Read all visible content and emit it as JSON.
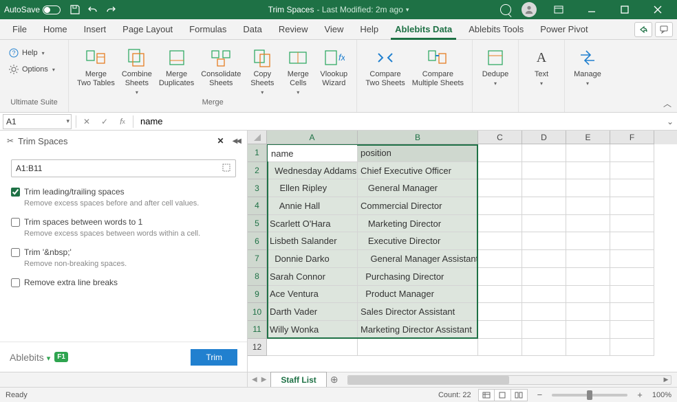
{
  "titlebar": {
    "autosave": "AutoSave",
    "doc_name": "Trim Spaces",
    "modified": "- Last Modified: 2m ago"
  },
  "tabs": {
    "file": "File",
    "home": "Home",
    "insert": "Insert",
    "pagelayout": "Page Layout",
    "formulas": "Formulas",
    "data": "Data",
    "review": "Review",
    "view": "View",
    "help": "Help",
    "abdata": "Ablebits Data",
    "abtools": "Ablebits Tools",
    "powerpivot": "Power Pivot"
  },
  "ribbon": {
    "help": "Help",
    "options": "Options",
    "group_ult": "Ultimate Suite",
    "merge_two_tables": "Merge\nTwo Tables",
    "combine_sheets": "Combine\nSheets",
    "merge_duplicates": "Merge\nDuplicates",
    "consolidate_sheets": "Consolidate\nSheets",
    "copy_sheets": "Copy\nSheets",
    "merge_cells": "Merge\nCells",
    "vlookup_wizard": "Vlookup\nWizard",
    "group_merge": "Merge",
    "compare_two": "Compare\nTwo Sheets",
    "compare_multi": "Compare\nMultiple Sheets",
    "dedupe": "Dedupe",
    "text": "Text",
    "manage": "Manage"
  },
  "formula_bar": {
    "namebox": "A1",
    "value": "name"
  },
  "sidepanel": {
    "title": "Trim Spaces",
    "range": "A1:B11",
    "opt1_label": "Trim leading/trailing spaces",
    "opt1_desc": "Remove excess spaces before and after cell values.",
    "opt2_label": "Trim spaces between words to 1",
    "opt2_desc": "Remove excess spaces between words within a cell.",
    "opt3_label": "Trim '&nbsp;'",
    "opt3_desc": "Remove non-breaking spaces.",
    "opt4_label": "Remove extra line breaks",
    "brand": "Ablebits",
    "f1": "F1",
    "trimbtn": "Trim"
  },
  "grid": {
    "cols": [
      "A",
      "B",
      "C",
      "D",
      "E",
      "F"
    ],
    "rows": [
      {
        "n": "1",
        "a": "name",
        "b": "position"
      },
      {
        "n": "2",
        "a": "  Wednesday Addams",
        "b": "Chief Executive Officer"
      },
      {
        "n": "3",
        "a": "    Ellen Ripley",
        "b": "   General Manager"
      },
      {
        "n": "4",
        "a": "    Annie Hall",
        "b": "Commercial Director"
      },
      {
        "n": "5",
        "a": "Scarlett O'Hara",
        "b": "   Marketing Director"
      },
      {
        "n": "6",
        "a": "Lisbeth Salander",
        "b": "   Executive Director"
      },
      {
        "n": "7",
        "a": "  Donnie Darko",
        "b": "    General Manager Assistant"
      },
      {
        "n": "8",
        "a": "Sarah Connor",
        "b": "  Purchasing Director"
      },
      {
        "n": "9",
        "a": "Ace Ventura",
        "b": "  Product Manager"
      },
      {
        "n": "10",
        "a": "Darth Vader",
        "b": "Sales Director Assistant"
      },
      {
        "n": "11",
        "a": "Willy Wonka",
        "b": "Marketing Director Assistant"
      }
    ]
  },
  "sheet_tab": "Staff List",
  "statusbar": {
    "ready": "Ready",
    "count": "Count: 22",
    "zoom": "100%"
  }
}
